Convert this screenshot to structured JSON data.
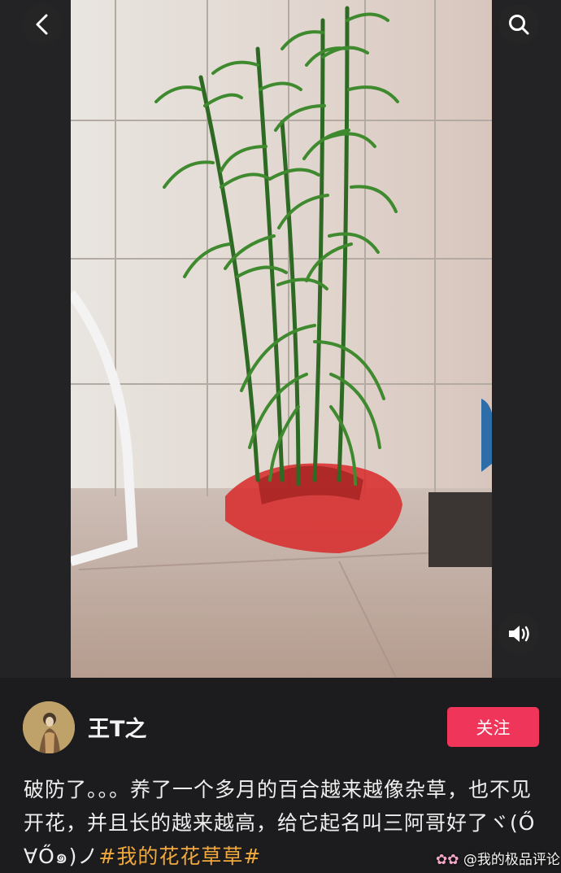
{
  "header": {
    "back_icon": "chevron-left-icon",
    "search_icon": "search-icon"
  },
  "media": {
    "volume_icon": "speaker-volume-icon"
  },
  "author": {
    "name": "王T之",
    "follow_label": "关注"
  },
  "post": {
    "caption_text": "破防了。。。养了一个多月的百合越来越像杂草，也不见开花，并且长的越来越高，给它起名叫三阿哥好了ヾ(Ő∀Ő๑)ノ",
    "hashtag": "#我的花花草草",
    "hashtag_trailing": "#"
  },
  "watermark": {
    "text": "@我的极品评论"
  },
  "colors": {
    "follow_button": "#f0355a",
    "hashtag": "#f2a93b",
    "background": "#1c1c1e"
  }
}
